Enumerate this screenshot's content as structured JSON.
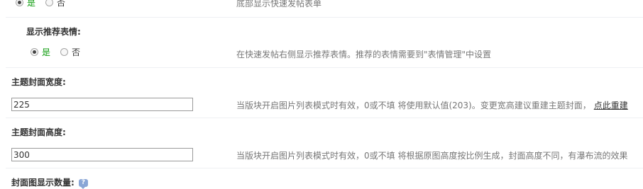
{
  "rows": {
    "top_partial": {
      "options": [
        "是",
        "否"
      ],
      "selected": "是",
      "description": "底部显示快速发帖表单"
    },
    "recommend_emoji": {
      "label": "显示推荐表情:",
      "options": [
        "是",
        "否"
      ],
      "selected": "是",
      "description": "在快速发帖右侧显示推荐表情。推荐的表情需要到\"表情管理\"中设置"
    },
    "cover_width": {
      "label": "主题封面宽度:",
      "value": "225",
      "description": "当版块开启图片列表模式时有效，0或不填 将使用默认值(203)。变更宽高建议重建主题封面，",
      "link": "点此重建"
    },
    "cover_height": {
      "label": "主题封面高度:",
      "value": "300",
      "description": "当版块开启图片列表模式时有效，0或不填 将根据原图高度按比例生成，封面高度不同，有瀑布流的效果"
    },
    "cover_count": {
      "label": "封面图显示数量:",
      "help_icon": "help-bubble-icon"
    }
  },
  "colors": {
    "selected_option": "#0a9a0a",
    "description": "#777777",
    "separator": "#eef0f3"
  }
}
